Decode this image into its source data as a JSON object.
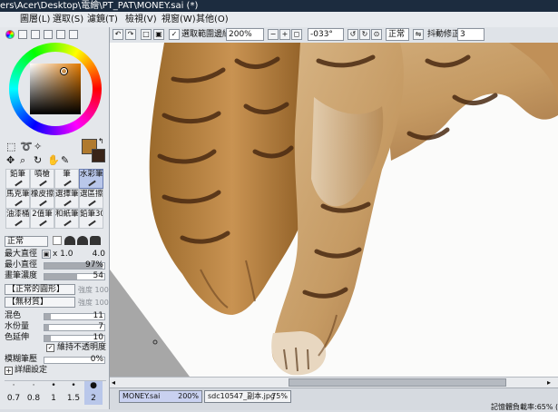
{
  "title_bar": {
    "text": "ers\\Acer\\Desktop\\電繪\\PT_PAT\\MONEY.sai (*)"
  },
  "menu": [
    "圖層(L)",
    "選取(S)",
    "濾鏡(T)",
    "檢視(V)",
    "視窗(W)",
    "其他(O)"
  ],
  "toolbar": {
    "selection_edge_checkbox_label": "選取範圍邊緣",
    "zoom_value": "200%",
    "rotation_value": "-033°",
    "blend_mode": "正常",
    "stabilizer_label": "抖動修正",
    "stabilizer_value": "3"
  },
  "colors": {
    "primary": "#b07a2e",
    "secondary": "#3a2418",
    "accent_select": "#b9c7ea"
  },
  "tools": {
    "rows": [
      [
        "鉛筆",
        "噴槍",
        "筆",
        "水彩筆"
      ],
      [
        "馬克筆",
        "橡皮擦",
        "選擇筆",
        "選區擦"
      ],
      [
        "油漆桶",
        "2值筆",
        "和紙筆",
        "鉛筆30"
      ]
    ],
    "selected": "水彩筆"
  },
  "brush": {
    "blend_label": "正常",
    "max_diameter_label": "最大直徑",
    "max_diameter_mult": "x 1.0",
    "max_diameter_value": "4.0",
    "min_diameter_label": "最小直徑",
    "min_diameter_value": "97%",
    "density_label": "畫筆濃度",
    "density_value": "54",
    "shape_label": "【正常的圓形】",
    "shape_strength": "強度 100",
    "texture_label": "【無材質】",
    "texture_strength": "強度 100",
    "blend_row_label": "混色",
    "blend_value": "11",
    "water_label": "水份量",
    "water_value": "7",
    "color_extend_label": "色延伸",
    "color_extend_value": "10",
    "keep_opacity_label": "維持不透明度",
    "blur_label": "模糊筆壓",
    "blur_value": "0%",
    "detail_label": "詳細設定",
    "preset_sizes": [
      "0.7",
      "0.8",
      "1",
      "1.5",
      "2"
    ]
  },
  "tabs": [
    {
      "name": "MONEY.sai",
      "zoom": "200%"
    },
    {
      "name": "sdc10547_副本.jpg",
      "zoom": "75%"
    }
  ],
  "status": {
    "text": "記憶體負載率:65% (記"
  }
}
